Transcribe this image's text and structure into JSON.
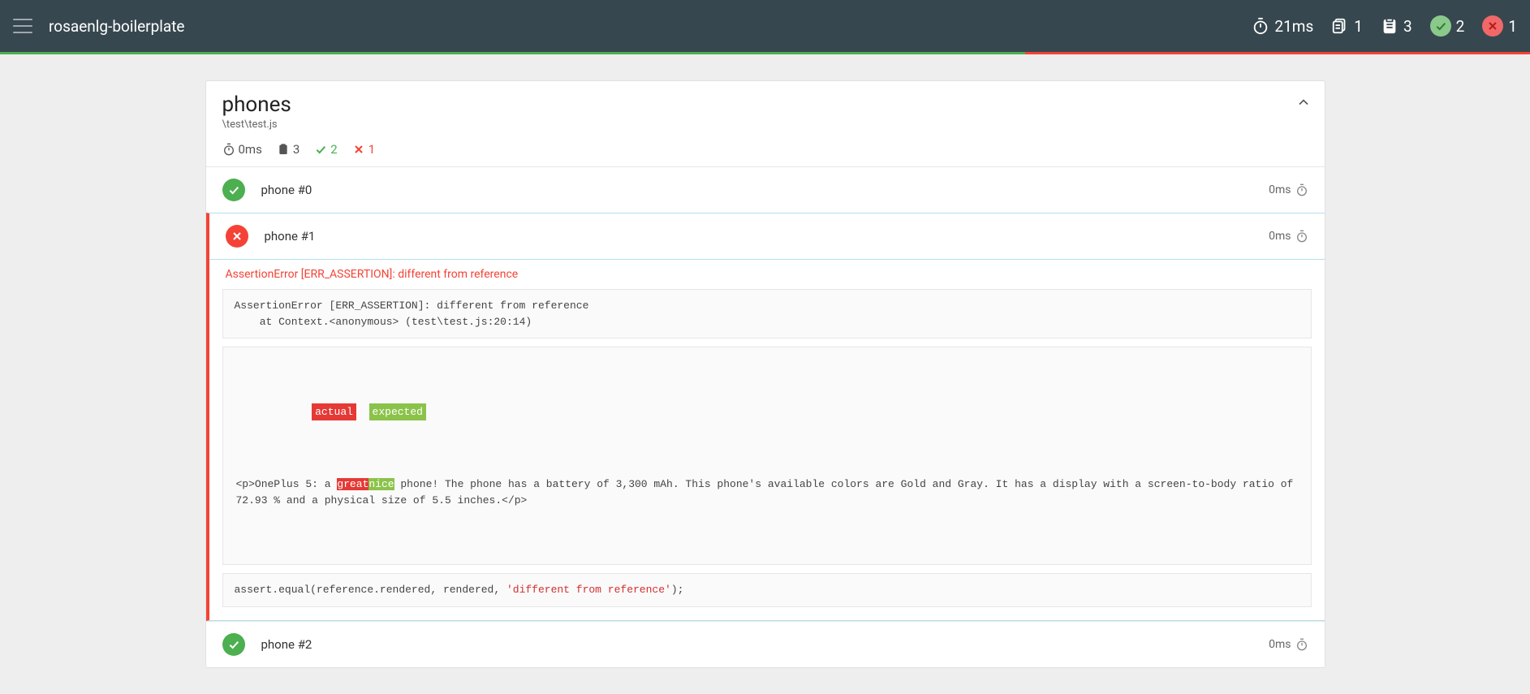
{
  "header": {
    "title": "rosaenlg-boilerplate",
    "duration": "21ms",
    "suites": "1",
    "tests": "3",
    "passed": "2",
    "failed": "1",
    "passPercent": 67,
    "failPercent": 33
  },
  "suite": {
    "title": "phones",
    "path": "\\test\\test.js",
    "duration": "0ms",
    "tests": "3",
    "passed": "2",
    "failed": "1"
  },
  "tests": [
    {
      "name": "phone #0",
      "status": "pass",
      "duration": "0ms"
    },
    {
      "name": "phone #1",
      "status": "fail",
      "duration": "0ms",
      "errorMessage": "AssertionError [ERR_ASSERTION]: different from reference",
      "stack": "AssertionError [ERR_ASSERTION]: different from reference\n    at Context.<anonymous> (test\\test.js:20:14)",
      "diff": {
        "labels": {
          "actual": "actual",
          "expected": "expected"
        },
        "pre": "<p>OnePlus 5: a ",
        "actual": "great",
        "expected": "nice",
        "post": " phone! The phone has a battery of 3,300 mAh. This phone's available colors are Gold and Gray. It has a display with a screen-to-body ratio of 72.93 % and a physical size of 5.5 inches.</p>"
      },
      "code": {
        "pre": "assert.equal(reference.rendered, rendered, ",
        "str": "'different from reference'",
        "post": ");"
      }
    },
    {
      "name": "phone #2",
      "status": "pass",
      "duration": "0ms"
    }
  ]
}
